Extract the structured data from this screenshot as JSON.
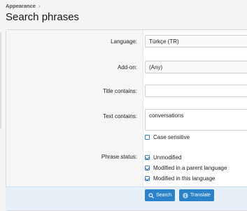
{
  "breadcrumb": {
    "parent": "Appearance",
    "chevron": "›"
  },
  "page_title": "Search phrases",
  "form": {
    "language": {
      "label": "Language:",
      "value": "Türkçe (TR)"
    },
    "addon": {
      "label": "Add-on:",
      "value": "(Any)"
    },
    "title_contains": {
      "label": "Title contains:",
      "value": ""
    },
    "text_contains": {
      "label": "Text contains:",
      "value": "conversations"
    },
    "case_sensitive": {
      "label": "Case sensitive",
      "checked": false
    },
    "phrase_status": {
      "label": "Phrase status:",
      "options": [
        {
          "label": "Unmodified",
          "checked": true
        },
        {
          "label": "Modified in a parent language",
          "checked": true
        },
        {
          "label": "Modified in this language",
          "checked": true
        }
      ]
    }
  },
  "buttons": {
    "search": "Search",
    "translate": "Translate"
  },
  "icons": {
    "search": "search-icon",
    "translate": "globe-icon"
  },
  "colors": {
    "accent": "#2c82c9",
    "footer_bg": "#e7f0f9"
  }
}
